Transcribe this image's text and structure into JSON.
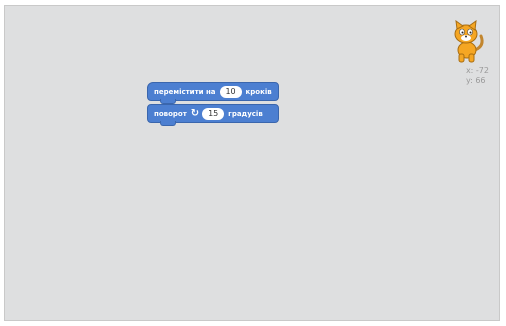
{
  "sprite": {
    "icon": "cat-sprite-icon",
    "x_label": "x:",
    "x_value": "-72",
    "y_label": "y:",
    "y_value": "66"
  },
  "blocks": [
    {
      "before": "перемістити на",
      "input": "10",
      "after": "кроків"
    },
    {
      "before": "поворот",
      "icon": "turn-right-icon",
      "input": "15",
      "after": "градусів"
    }
  ],
  "colors": {
    "block": "#4c7fd1",
    "canvas": "#dedfe0"
  }
}
